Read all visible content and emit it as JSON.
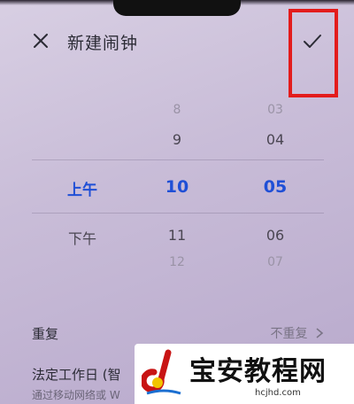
{
  "header": {
    "title": "新建闹钟",
    "close_icon": "close-icon",
    "confirm_icon": "check-icon"
  },
  "picker": {
    "ampm": {
      "selected": "上午",
      "below": "下午"
    },
    "hours": {
      "far_above": "8",
      "above": "9",
      "selected": "10",
      "below": "11",
      "far_below": "12"
    },
    "minutes": {
      "far_above": "03",
      "above": "04",
      "selected": "05",
      "below": "06",
      "far_below": "07"
    }
  },
  "settings": {
    "repeat_label": "重复",
    "repeat_value": "不重复",
    "workday_label": "法定工作日 (智",
    "workday_sub": "通过移动网络或 W"
  },
  "watermark": {
    "name": "宝安教程网",
    "url": "hcjhd.com"
  },
  "colors": {
    "accent": "#1f4fd6",
    "highlight": "#e31c1c"
  }
}
